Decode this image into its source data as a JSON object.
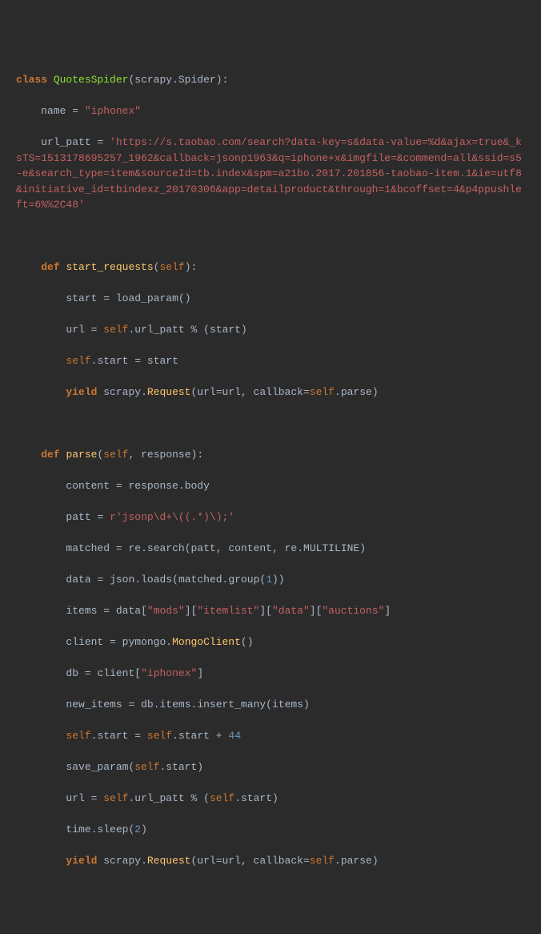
{
  "code": {
    "class_kw": "class",
    "class_name": "QuotesSpider",
    "class_base": "scrapy.Spider",
    "name_var": "name",
    "name_val": "\"iphonex\"",
    "urlpatt_var": "url_patt",
    "urlpatt_val": "'https://s.taobao.com/search?data-key=s&data-value=%d&ajax=true&_ksTS=1513178695257_1962&callback=jsonp1963&q=iphone+x&imgfile=&commend=all&ssid=s5-e&search_type=item&sourceId=tb.index&spm=a21bo.2017.201856-taobao-item.1&ie=utf8&initiative_id=tbindexz_20170306&app=detailproduct&through=1&bcoffset=4&p4ppushleft=6%%2C48'",
    "def_kw": "def",
    "start_requests_name": "start_requests",
    "self_kw": "self",
    "start_var": "start",
    "load_param": "load_param",
    "url_var": "url",
    "url_patt_ref": "url_patt",
    "yield_kw": "yield",
    "scrapy_mod": "scrapy",
    "request_cls": "Request",
    "callback_kw": "callback",
    "url_kw_arg": "url",
    "parse_name": "parse",
    "response_arg": "response",
    "content_var": "content",
    "body_attr": "body",
    "patt_var": "patt",
    "patt_val": "r'jsonp\\d+\\((.*)\\);'",
    "matched_var": "matched",
    "re_mod": "re",
    "search_fn": "search",
    "multiline": "MULTILINE",
    "data_var": "data",
    "json_mod": "json",
    "loads_fn": "loads",
    "group_fn": "group",
    "group_arg": "1",
    "items_var": "items",
    "key_mods": "\"mods\"",
    "key_itemlist": "\"itemlist\"",
    "key_data": "\"data\"",
    "key_auctions": "\"auctions\"",
    "client_var": "client",
    "pymongo_mod": "pymongo",
    "mongoclient": "MongoClient",
    "db_var": "db",
    "db_key": "\"iphonex\"",
    "new_items_var": "new_items",
    "insert_many": "insert_many",
    "items_attr": "items",
    "plus_val": "44",
    "save_param": "save_param",
    "time_mod": "time",
    "sleep_fn": "sleep",
    "sleep_arg": "2"
  }
}
